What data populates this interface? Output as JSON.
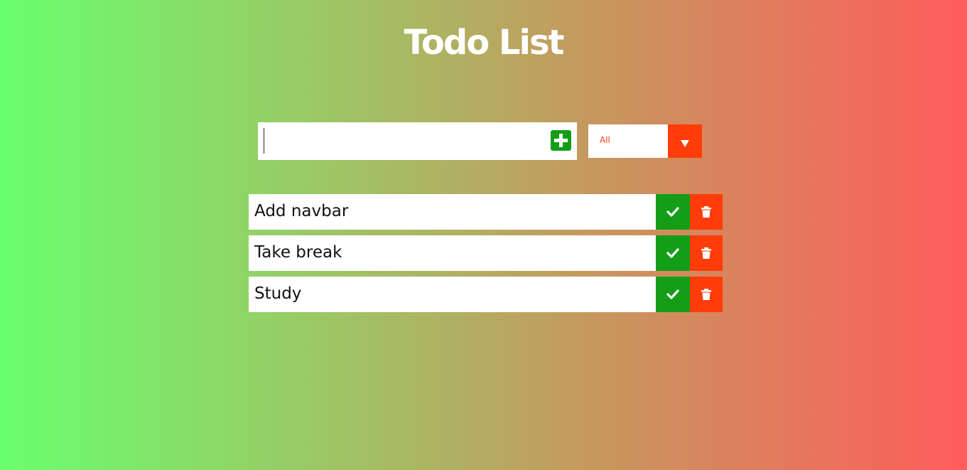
{
  "header": {
    "title": "Todo List"
  },
  "form": {
    "input_value": "",
    "input_placeholder": "",
    "add_icon": "plus-square-icon"
  },
  "filter": {
    "selected": "All",
    "arrow_icon": "chevron-down-icon"
  },
  "todos": [
    {
      "text": "Add navbar",
      "complete_icon": "check-icon",
      "delete_icon": "trash-icon"
    },
    {
      "text": "Take break",
      "complete_icon": "check-icon",
      "delete_icon": "trash-icon"
    },
    {
      "text": "Study",
      "complete_icon": "check-icon",
      "delete_icon": "trash-icon"
    }
  ],
  "colors": {
    "gradient_left": "#69ff6e",
    "gradient_right": "#ff5c5c",
    "complete": "#149e18",
    "delete": "#ff3c0a",
    "title": "#ffffff"
  }
}
